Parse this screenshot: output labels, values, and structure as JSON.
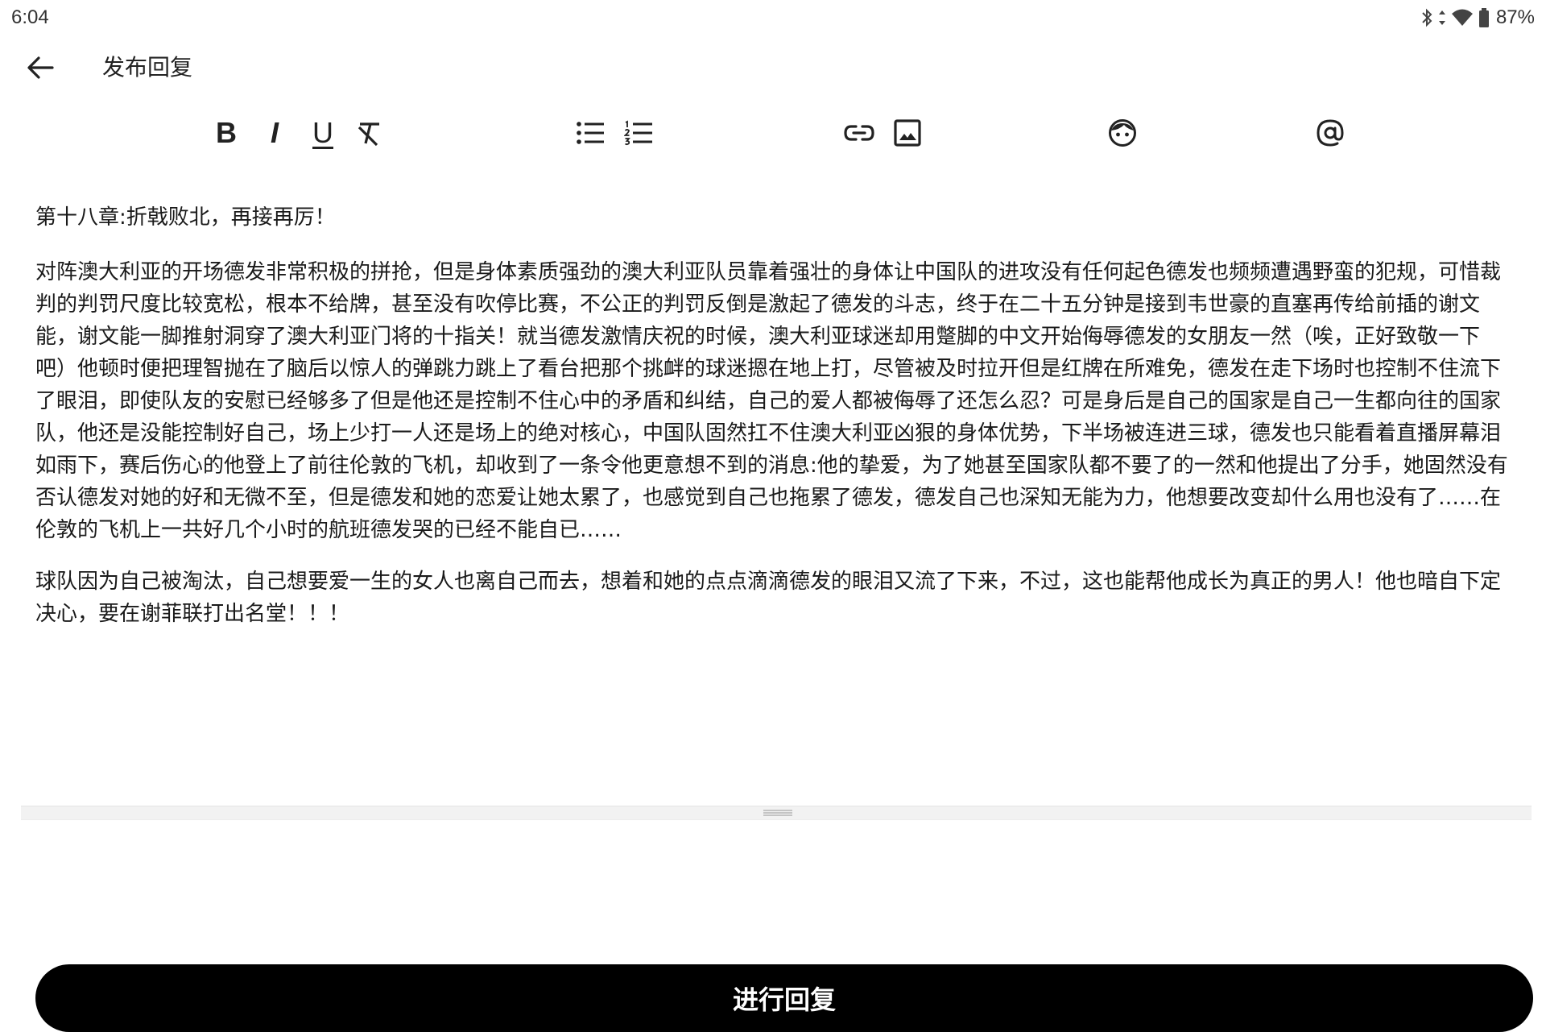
{
  "status_bar": {
    "time": "6:04",
    "battery": "87%",
    "icons": [
      "bluetooth-icon",
      "data-arrows-icon",
      "wifi-icon",
      "battery-icon"
    ]
  },
  "app_bar": {
    "back_icon": "arrow-left-icon",
    "title": "发布回复"
  },
  "toolbar": {
    "bold": "B",
    "italic": "I",
    "underline": "U",
    "icons": [
      "bold-icon",
      "italic-icon",
      "underline-icon",
      "clear-format-icon",
      "bullet-list-icon",
      "numbered-list-icon",
      "link-icon",
      "image-icon",
      "emoji-icon",
      "mention-icon"
    ]
  },
  "editor": {
    "heading": "第十八章:折戟败北，再接再厉！",
    "paragraph1": "对阵澳大利亚的开场德发非常积极的拼抢，但是身体素质强劲的澳大利亚队员靠着强壮的身体让中国队的进攻没有任何起色德发也频频遭遇野蛮的犯规，可惜裁判的判罚尺度比较宽松，根本不给牌，甚至没有吹停比赛，不公正的判罚反倒是激起了德发的斗志，终于在二十五分钟是接到韦世豪的直塞再传给前插的谢文能，谢文能一脚推射洞穿了澳大利亚门将的十指关！就当德发激情庆祝的时候，澳大利亚球迷却用蹩脚的中文开始侮辱德发的女朋友一然（唉，正好致敬一下吧）他顿时便把理智抛在了脑后以惊人的弹跳力跳上了看台把那个挑衅的球迷摁在地上打，尽管被及时拉开但是红牌在所难免，德发在走下场时也控制不住流下了眼泪，即使队友的安慰已经够多了但是他还是控制不住心中的矛盾和纠结，自己的爱人都被侮辱了还怎么忍？可是身后是自己的国家是自己一生都向往的国家队，他还是没能控制好自己，场上少打一人还是场上的绝对核心，中国队固然扛不住澳大利亚凶狠的身体优势，下半场被连进三球，德发也只能看着直播屏幕泪如雨下，赛后伤心的他登上了前往伦敦的飞机，却收到了一条令他更意想不到的消息:他的挚爱，为了她甚至国家队都不要了的一然和他提出了分手，她固然没有否认德发对她的好和无微不至，但是德发和她的恋爱让她太累了，也感觉到自己也拖累了德发，德发自己也深知无能为力，他想要改变却什么用也没有了……在伦敦的飞机上一共好几个小时的航班德发哭的已经不能自已……",
    "paragraph2": "球队因为自己被淘汰，自己想要爱一生的女人也离自己而去，想着和她的点点滴滴德发的眼泪又流了下来，不过，这也能帮他成长为真正的男人！他也暗自下定决心，要在谢菲联打出名堂！！！"
  },
  "divider": {
    "handle_icon": "drag-handle-icon"
  },
  "submit": {
    "label": "进行回复"
  },
  "colors": {
    "text": "#1a1a1a",
    "button_bg": "#000000",
    "button_text": "#ffffff",
    "divider": "#f2f2f2"
  }
}
